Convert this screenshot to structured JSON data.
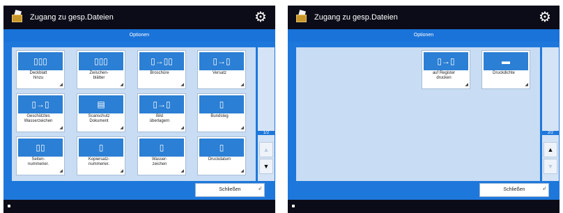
{
  "screens": [
    {
      "title": "Zugang zu gesp.Dateien",
      "section": "Optionen",
      "page": "1/2",
      "tiles": [
        {
          "label": "Deckblatt\nhinzu",
          "glyph": "▯▯▯"
        },
        {
          "label": "Zwischen-\nblätter",
          "glyph": "▯▯▯"
        },
        {
          "label": "Broschüre",
          "glyph": "▯→▯▯"
        },
        {
          "label": "Versatz",
          "glyph": "▯→▯"
        },
        {
          "label": "Geschütztes\nWasserzeichen",
          "glyph": "▯→▯"
        },
        {
          "label": "Scanschutz\nDokument",
          "glyph": "▤"
        },
        {
          "label": "Bild\nüberlagern",
          "glyph": "▯→▯"
        },
        {
          "label": "Bundsteg",
          "glyph": "▯"
        },
        {
          "label": "Seiten-\nnummerier.",
          "glyph": "▯▯"
        },
        {
          "label": "Kopiersatz-\nnummerier.",
          "glyph": "▯"
        },
        {
          "label": "Wasser-\nzeichen",
          "glyph": "▯"
        },
        {
          "label": "Druckdatum",
          "glyph": "▯"
        }
      ],
      "up_arrow": "▲",
      "down_arrow": "▼",
      "close_label": "Schließen"
    },
    {
      "title": "Zugang zu gesp.Dateien",
      "section": "Optionen",
      "page": "2/2",
      "tiles": [
        {
          "label": "auf Register\ndrucken",
          "glyph": "▯→▯"
        },
        {
          "label": "Druckdichte",
          "glyph": "▬"
        }
      ],
      "up_arrow": "▲",
      "down_arrow": "▼",
      "close_label": "Schließen"
    }
  ],
  "colors": {
    "accent": "#1e78db",
    "topbar": "#0c0c18",
    "tile_image": "#2b7fd4"
  },
  "icons": {
    "app": "storage-box-icon",
    "settings": "gear-icon"
  }
}
